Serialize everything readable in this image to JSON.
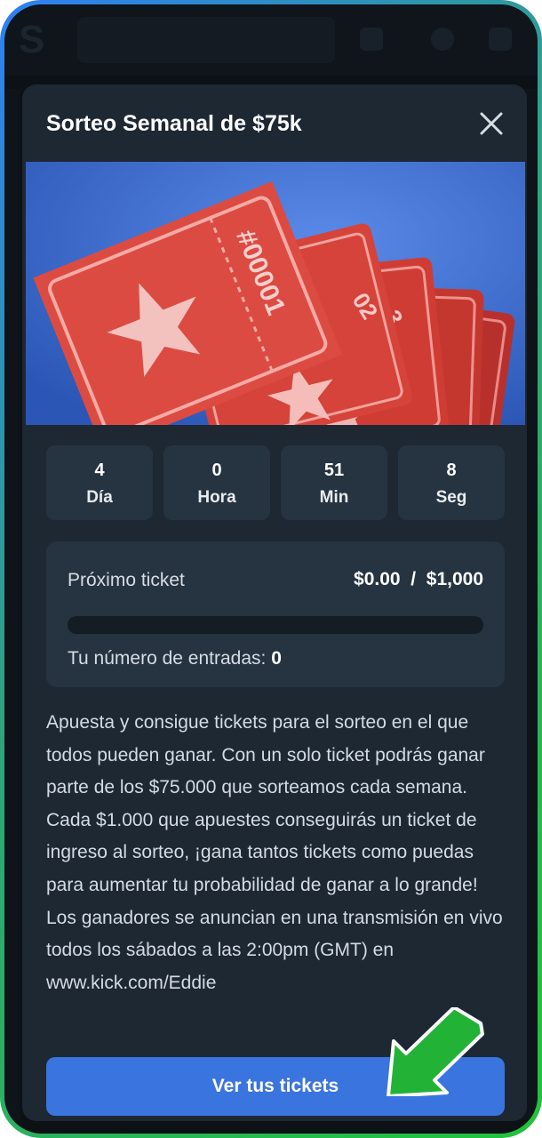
{
  "modal": {
    "title": "Sorteo Semanal de $75k"
  },
  "hero": {
    "ticket_number": "#00001",
    "ticket_number_2": "02",
    "ticket_number_3": "3"
  },
  "countdown": [
    {
      "value": "4",
      "unit": "Día"
    },
    {
      "value": "0",
      "unit": "Hora"
    },
    {
      "value": "51",
      "unit": "Min"
    },
    {
      "value": "8",
      "unit": "Seg"
    }
  ],
  "ticket_progress": {
    "label": "Próximo ticket",
    "current": "$0.00",
    "separator": "/",
    "goal": "$1,000",
    "progress_fraction": 0,
    "entries_label": "Tu número de entradas:",
    "entries_count": "0"
  },
  "description": "Apuesta y consigue tickets para el sorteo en el que todos pueden ganar. Con un solo ticket podrás ganar parte de los $75.000 que sorteamos cada semana. Cada $1.000 que apuestes conseguirás un ticket de ingreso al sorteo, ¡gana tantos tickets como puedas para aumentar tu probabilidad de ganar a lo grande! Los ganadores se anuncian en una transmisión en vivo todos los sábados a las 2:00pm (GMT) en www.kick.com/Eddie",
  "cta": {
    "label": "Ver tus tickets"
  },
  "colors": {
    "accent": "#3a74de",
    "modal_bg": "#1d2833",
    "card_bg": "#263340",
    "ticket_red": "#d9443f",
    "arrow_green": "#22b236"
  },
  "icons": {
    "close": "close-icon",
    "arrow": "pointer-arrow-icon",
    "star": "star-icon"
  }
}
